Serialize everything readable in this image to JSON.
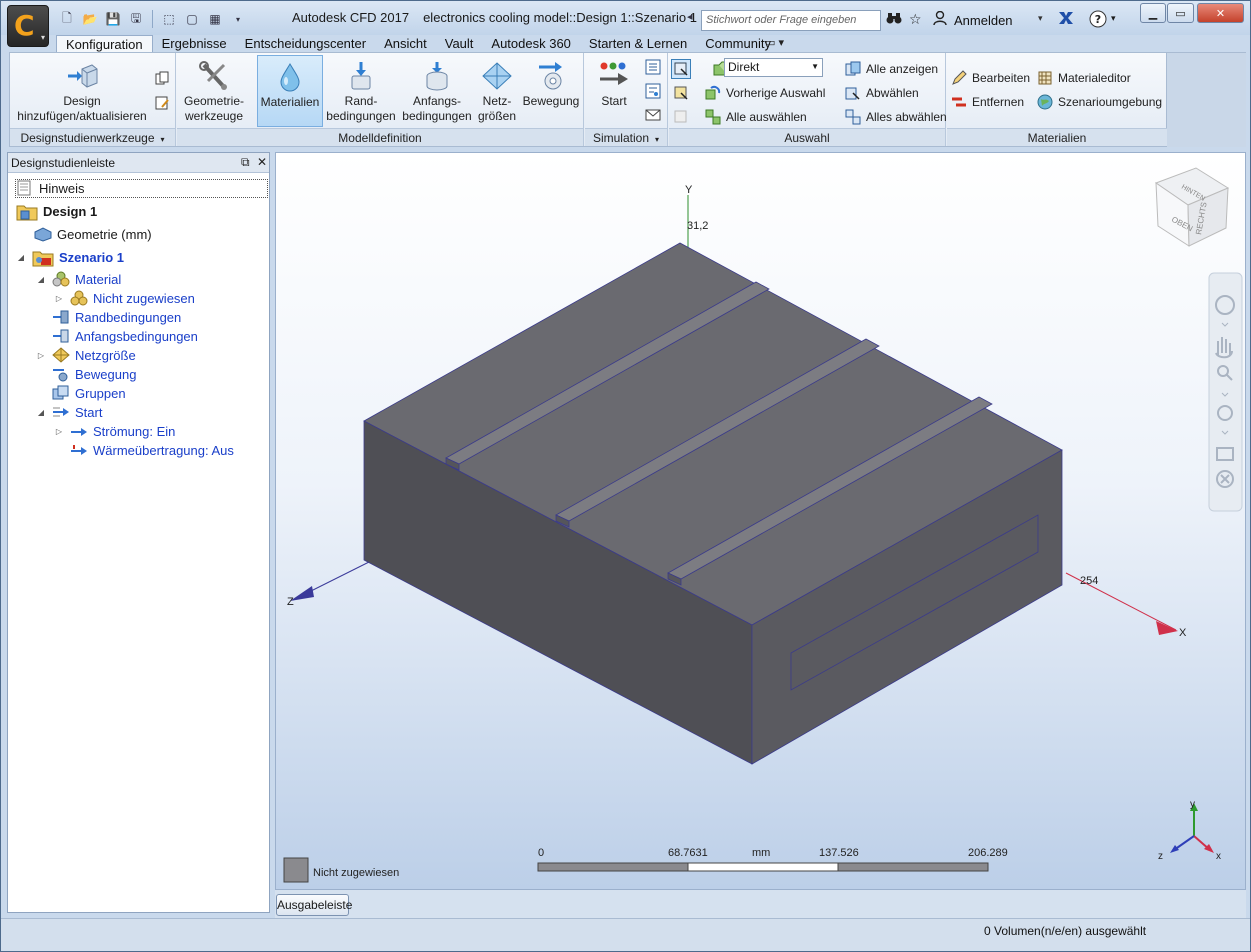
{
  "window": {
    "title_app": "Autodesk CFD 2017",
    "title_doc": "electronics cooling model::Design 1::Szenario 1",
    "search_placeholder": "Stichwort oder Frage eingeben",
    "signin_label": "Anmelden",
    "app_letter": "C"
  },
  "tabs": [
    {
      "label": "Konfiguration",
      "active": true
    },
    {
      "label": "Ergebnisse"
    },
    {
      "label": "Entscheidungscenter"
    },
    {
      "label": "Ansicht"
    },
    {
      "label": "Vault"
    },
    {
      "label": "Autodesk 360"
    },
    {
      "label": "Starten & Lernen"
    },
    {
      "label": "Community"
    }
  ],
  "ribbon": {
    "design_btn": "Design\nhinzufügen/aktualisieren",
    "design_btn_l1": "Design",
    "design_btn_l2": "hinzufügen/aktualisieren",
    "geom_l1": "Geometrie-",
    "geom_l2": "werkzeuge",
    "mat_l1": "Materialien",
    "rand_l1": "Rand-",
    "rand_l2": "bedingungen",
    "anf_l1": "Anfangs-",
    "anf_l2": "bedingungen",
    "netz_l1": "Netz-",
    "netz_l2": "größen",
    "bew_l1": "Bewegung",
    "start_l1": "Start",
    "combo_value": "Direkt",
    "vorherige": "Vorherige Auswahl",
    "alle_auswaehlen": "Alle auswählen",
    "alle_anzeigen": "Alle anzeigen",
    "abwaehlen": "Abwählen",
    "alles_abwaehlen": "Alles abwählen",
    "bearbeiten": "Bearbeiten",
    "entfernen": "Entfernen",
    "materialeditor": "Materialeditor",
    "szenarioumgebung": "Szenarioumgebung",
    "panel_design": "Designstudienwerkzeuge",
    "panel_modell": "Modelldefinition",
    "panel_sim": "Simulation",
    "panel_auswahl": "Auswahl",
    "panel_mat": "Materialien"
  },
  "sidebar": {
    "title": "Designstudienleiste",
    "tree": [
      {
        "label": "Hinweis"
      },
      {
        "label": "Design 1"
      },
      {
        "label": "Geometrie (mm)"
      },
      {
        "label": "Szenario 1"
      },
      {
        "label": "Material"
      },
      {
        "label": "Nicht zugewiesen"
      },
      {
        "label": "Randbedingungen"
      },
      {
        "label": "Anfangsbedingungen"
      },
      {
        "label": "Netzgröße"
      },
      {
        "label": "Bewegung"
      },
      {
        "label": "Gruppen"
      },
      {
        "label": "Start"
      },
      {
        "label": "Strömung: Ein"
      },
      {
        "label": "Wärmeübertragung: Aus"
      }
    ]
  },
  "viewport": {
    "axis_y": "Y",
    "axis_x": "X",
    "axis_z": "Z",
    "y_value": "31,2",
    "x_value": "254",
    "viewcube_top": "OBEN",
    "viewcube_right": "RECHTS",
    "viewcube_back": "HINTEN",
    "legend_label": "Nicht zugewiesen",
    "scale_ticks": [
      "0",
      "68.7631",
      "mm",
      "137.526",
      "206.289"
    ],
    "triad_y": "y",
    "triad_x": "x",
    "triad_z": "z"
  },
  "bottom": {
    "output_button": "Ausgabeleiste",
    "status": "0 Volumen(n/e/en) ausgewählt"
  }
}
